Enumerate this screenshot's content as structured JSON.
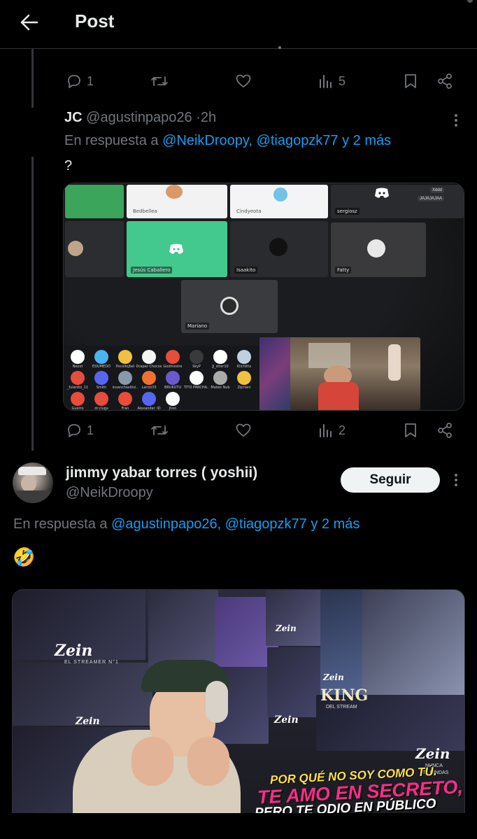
{
  "header": {
    "title": "Post"
  },
  "tweet1": {
    "actions": {
      "replies": "1",
      "views": "5"
    }
  },
  "tweet2": {
    "name": "JC",
    "handle": "@agustinpapo26",
    "sep": "·",
    "time": "2h",
    "reply_prefix": "En respuesta a",
    "reply_to": [
      "@NeikDroopy,",
      "@tiagopzk77"
    ],
    "reply_more": "y 2 más",
    "text": "?",
    "actions": {
      "replies": "1",
      "views": "2"
    },
    "image": {
      "tiles": [
        "Bedbellea",
        "Cindyeota",
        "sergiosz",
        "Jesús Caballero",
        "Isaakito",
        "Fatty",
        "Mariano"
      ],
      "badges": [
        "Xddd",
        "JAJAJAJAA"
      ],
      "strip_names": [
        "Nexxt",
        "EDUMEDO",
        "Pocollojbel",
        "Draper Chocos",
        "Godmeshe",
        "SkyP",
        "JJ_stter10",
        "Klichitto",
        "_fulanito_11",
        "Smith",
        "insanchasitisi..",
        "Lanzo33",
        "BRUKUTU",
        "TITO PARCHA..",
        "Mateo Nub",
        "Zipriani",
        "Guerro",
        "dr.clugs",
        "Fran",
        "Alexander_ID",
        "Jhon"
      ]
    }
  },
  "tweet3": {
    "name": "jimmy yabar torres ( yoshii)",
    "handle": "@NeikDroopy",
    "follow_label": "Seguir",
    "reply_prefix": "En respuesta a",
    "reply_to": [
      "@agustinpapo26,",
      "@tiagopzk77"
    ],
    "reply_more": "y 2 más",
    "emoji": "🤣",
    "image": {
      "poster_brand": "Zein",
      "poster_sub": "EL STREAMER N°1",
      "king_line1": "KING",
      "king_line2": "DEL STREAM",
      "nunca": "NUNCA",
      "te_rindas": "TE RINDAS",
      "caption_line1": "POR QUÉ NO SOY COMO TÚ.",
      "caption_line2": "TE AMO EN SECRETO,",
      "caption_line3": "PERO TE ODIO EN PÚBLICO"
    }
  },
  "colors": {
    "link": "#1d9bf0",
    "muted": "#71767b",
    "bg": "#000000",
    "caption_pink": "#ff2d8a",
    "caption_yellow": "#ffe14a"
  }
}
